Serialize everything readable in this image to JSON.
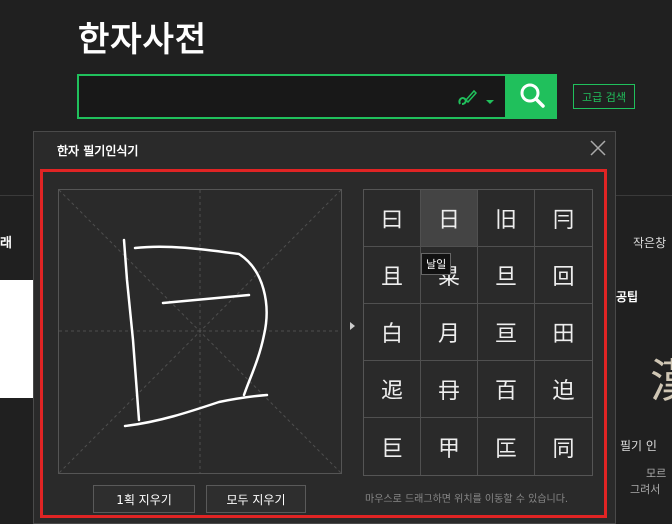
{
  "header": {
    "title": "한자사전"
  },
  "search": {
    "placeholder": "",
    "tools_icon": "pen-link-icon",
    "submit_icon": "search-icon",
    "advanced_label": "고급 검색"
  },
  "background": {
    "left_label": "래",
    "right_small": "작은창",
    "right_tip": "공팁",
    "right_big_char": "漢",
    "right_text1": "필기 인",
    "right_text2": "모르",
    "right_text3": "그려서"
  },
  "panel": {
    "title": "한자 필기인식기",
    "candidates": [
      "曰",
      "日",
      "旧",
      "冃",
      "且",
      "㫧",
      "旦",
      "回",
      "白",
      "月",
      "亘",
      "田",
      "迡",
      "冄",
      "百",
      "迫",
      "巨",
      "甲",
      "匞",
      "同"
    ],
    "selected_index": 1,
    "tooltip": "날일",
    "buttons": {
      "clear_stroke": "1획 지우기",
      "clear_all": "모두 지우기"
    },
    "hint": "마우스로 드래그하면 위치를 이동할 수 있습니다."
  },
  "colors": {
    "accent": "#20c05c",
    "highlight": "#e02424",
    "background": "#202020"
  }
}
